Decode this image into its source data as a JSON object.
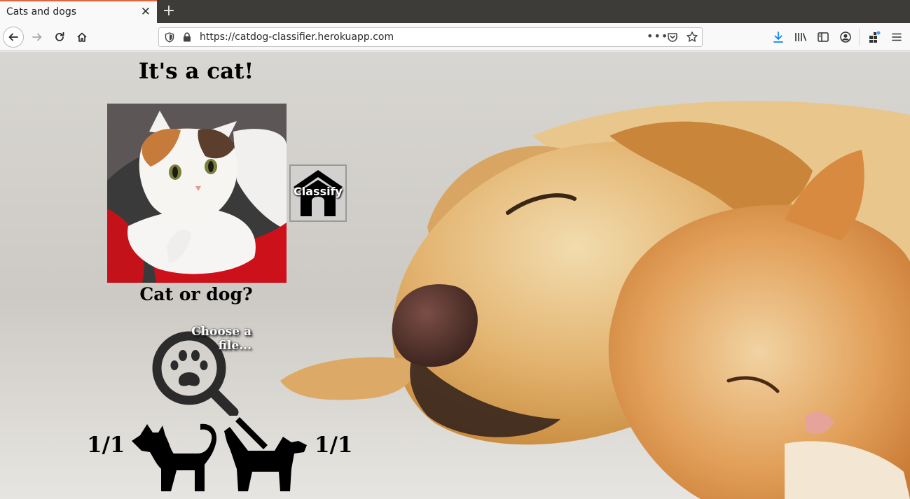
{
  "tab": {
    "title": "Cats and dogs",
    "close_glyph": "✕",
    "new_tab_glyph": "+"
  },
  "urlbar": {
    "url": "https://catdog-classifier.herokuapp.com",
    "more_glyph": "•••"
  },
  "toolbar": {
    "icons": [
      "download-icon",
      "library-icon",
      "sidebar-icon",
      "account-icon",
      "extensions-icon",
      "menu-icon"
    ],
    "download_color": "#0a84ff"
  },
  "page": {
    "result": "It's a cat!",
    "classify_label": "Classify",
    "question": "Cat or dog?",
    "choose_file_label": "Choose a file...",
    "cat_count": "1/1",
    "dog_count": "1/1"
  },
  "colors": {
    "tabbar": "#3e3c38",
    "tab_accent": "#e0663c",
    "text": "#000000"
  }
}
